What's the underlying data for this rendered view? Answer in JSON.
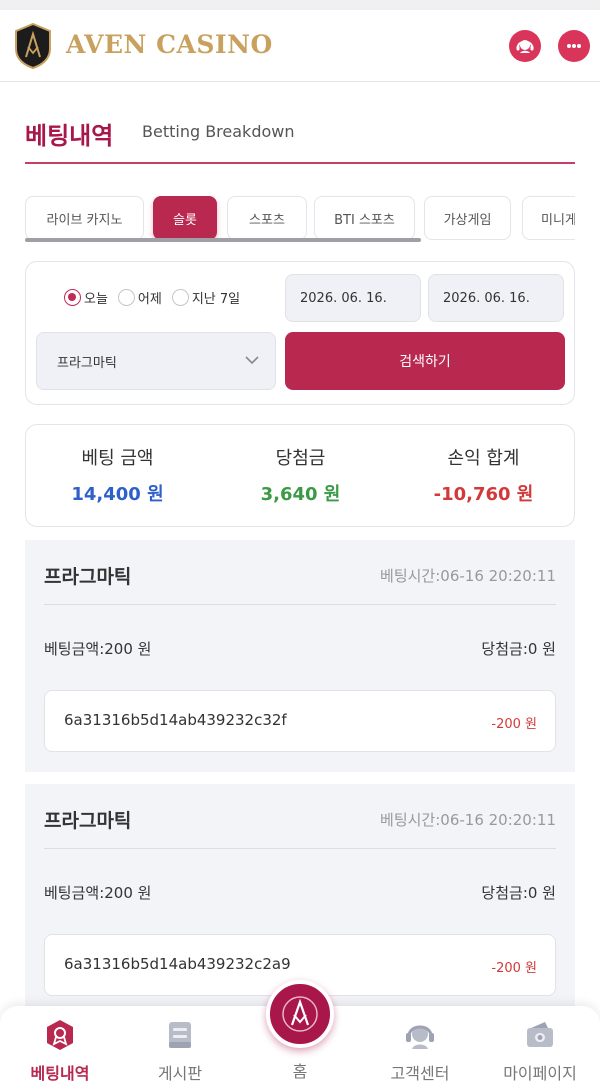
{
  "brand": {
    "name": "AVEN CASINO",
    "logo_letters": "AV"
  },
  "header": {
    "support_icon": "headset-icon",
    "chat_icon": "chat-bubble-icon"
  },
  "page": {
    "title": "베팅내역",
    "subtitle": "Betting Breakdown"
  },
  "tabs": [
    {
      "label": "라이브 카지노",
      "active": false
    },
    {
      "label": "슬롯",
      "active": true
    },
    {
      "label": "스포츠",
      "active": false
    },
    {
      "label": "BTI 스포츠",
      "active": false
    },
    {
      "label": "가상게임",
      "active": false
    },
    {
      "label": "미니게",
      "active": false
    }
  ],
  "filter": {
    "periods": [
      {
        "label": "오늘",
        "checked": true
      },
      {
        "label": "어제",
        "checked": false
      },
      {
        "label": "지난 7일",
        "checked": false
      }
    ],
    "date_from": "2026. 06. 16.",
    "date_to": "2026. 06. 16.",
    "provider_selected": "프라그마틱",
    "search_label": "검색하기"
  },
  "summary": {
    "bet_label": "베팅 금액",
    "bet_value": "14,400 원",
    "win_label": "당첨금",
    "win_value": "3,640 원",
    "pl_label": "손익 합계",
    "pl_value": "-10,760 원"
  },
  "bets": [
    {
      "provider": "프라그마틱",
      "time": "베팅시간:06-16 20:20:11",
      "amount": "베팅금액:200 원",
      "win": "당첨금:0 원",
      "id": "6a31316b5d14ab439232c32f",
      "pl": "-200 원"
    },
    {
      "provider": "프라그마틱",
      "time": "베팅시간:06-16 20:20:11",
      "amount": "베팅금액:200 원",
      "win": "당첨금:0 원",
      "id": "6a31316b5d14ab439232c2a9",
      "pl": "-200 원"
    }
  ],
  "nav": {
    "items": [
      {
        "label": "베팅내역",
        "icon": "betting-history-icon",
        "active": true
      },
      {
        "label": "게시판",
        "icon": "board-icon",
        "active": false
      },
      {
        "label": "홈",
        "icon": "home-logo-icon",
        "active": false
      },
      {
        "label": "고객센터",
        "icon": "headset-icon",
        "active": false
      },
      {
        "label": "마이페이지",
        "icon": "wallet-icon",
        "active": false
      }
    ]
  },
  "colors": {
    "accent": "#b8284f",
    "gold": "#c9a15e",
    "bet_value": "#2f5fc8",
    "win_value": "#3a9a45",
    "pl_value": "#d23a3a"
  }
}
